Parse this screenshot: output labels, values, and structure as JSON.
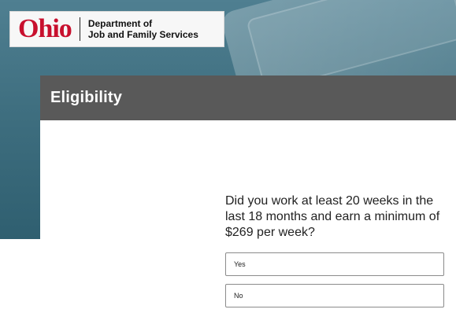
{
  "logo": {
    "ohio": "Ohio",
    "dept_line1": "Department of",
    "dept_line2": "Job and Family Services",
    "brand_color": "#c8102e"
  },
  "header": {
    "title": "Eligibility"
  },
  "question": {
    "text": "Did you work at least 20 weeks in the last 18 months and earn a minimum of $269 per week?"
  },
  "options": [
    {
      "label": "Yes"
    },
    {
      "label": "No"
    }
  ],
  "colors": {
    "header_bg": "#595959",
    "hero_bg": "#3f6f80"
  }
}
